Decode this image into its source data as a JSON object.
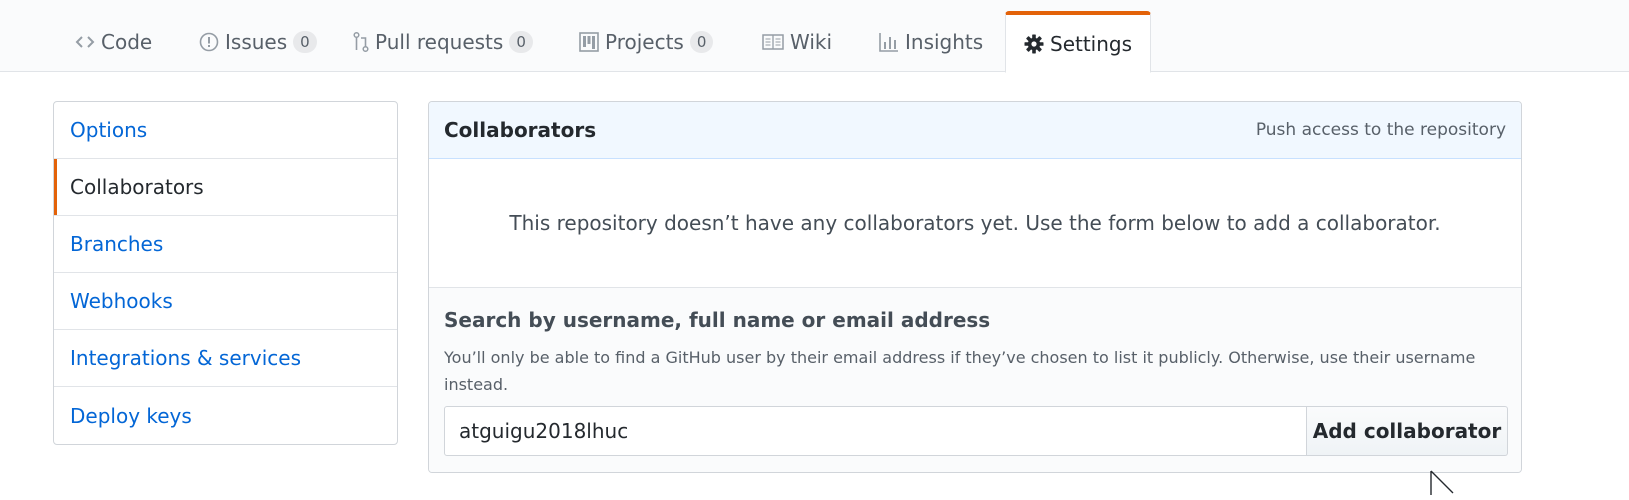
{
  "nav": {
    "tabs": [
      {
        "label": "Code",
        "icon": "code-icon"
      },
      {
        "label": "Issues",
        "icon": "issue-icon",
        "count": "0"
      },
      {
        "label": "Pull requests",
        "icon": "pull-request-icon",
        "count": "0"
      },
      {
        "label": "Projects",
        "icon": "project-icon",
        "count": "0"
      },
      {
        "label": "Wiki",
        "icon": "book-icon"
      },
      {
        "label": "Insights",
        "icon": "graph-icon"
      },
      {
        "label": "Settings",
        "icon": "gear-icon",
        "selected": true
      }
    ],
    "accent_color": "#e36209"
  },
  "sidebar": {
    "items": [
      {
        "label": "Options"
      },
      {
        "label": "Collaborators",
        "selected": true
      },
      {
        "label": "Branches"
      },
      {
        "label": "Webhooks"
      },
      {
        "label": "Integrations & services"
      },
      {
        "label": "Deploy keys"
      }
    ]
  },
  "collaborators": {
    "title": "Collaborators",
    "note": "Push access to the repository",
    "empty_message": "This repository doesn’t have any collaborators yet. Use the form below to add a collaborator.",
    "search_label": "Search by username, full name or email address",
    "search_note": "You’ll only be able to find a GitHub user by their email address if they’ve chosen to list it publicly. Otherwise, use their username instead.",
    "search_value": "atguigu2018lhuc",
    "add_button": "Add collaborator"
  }
}
